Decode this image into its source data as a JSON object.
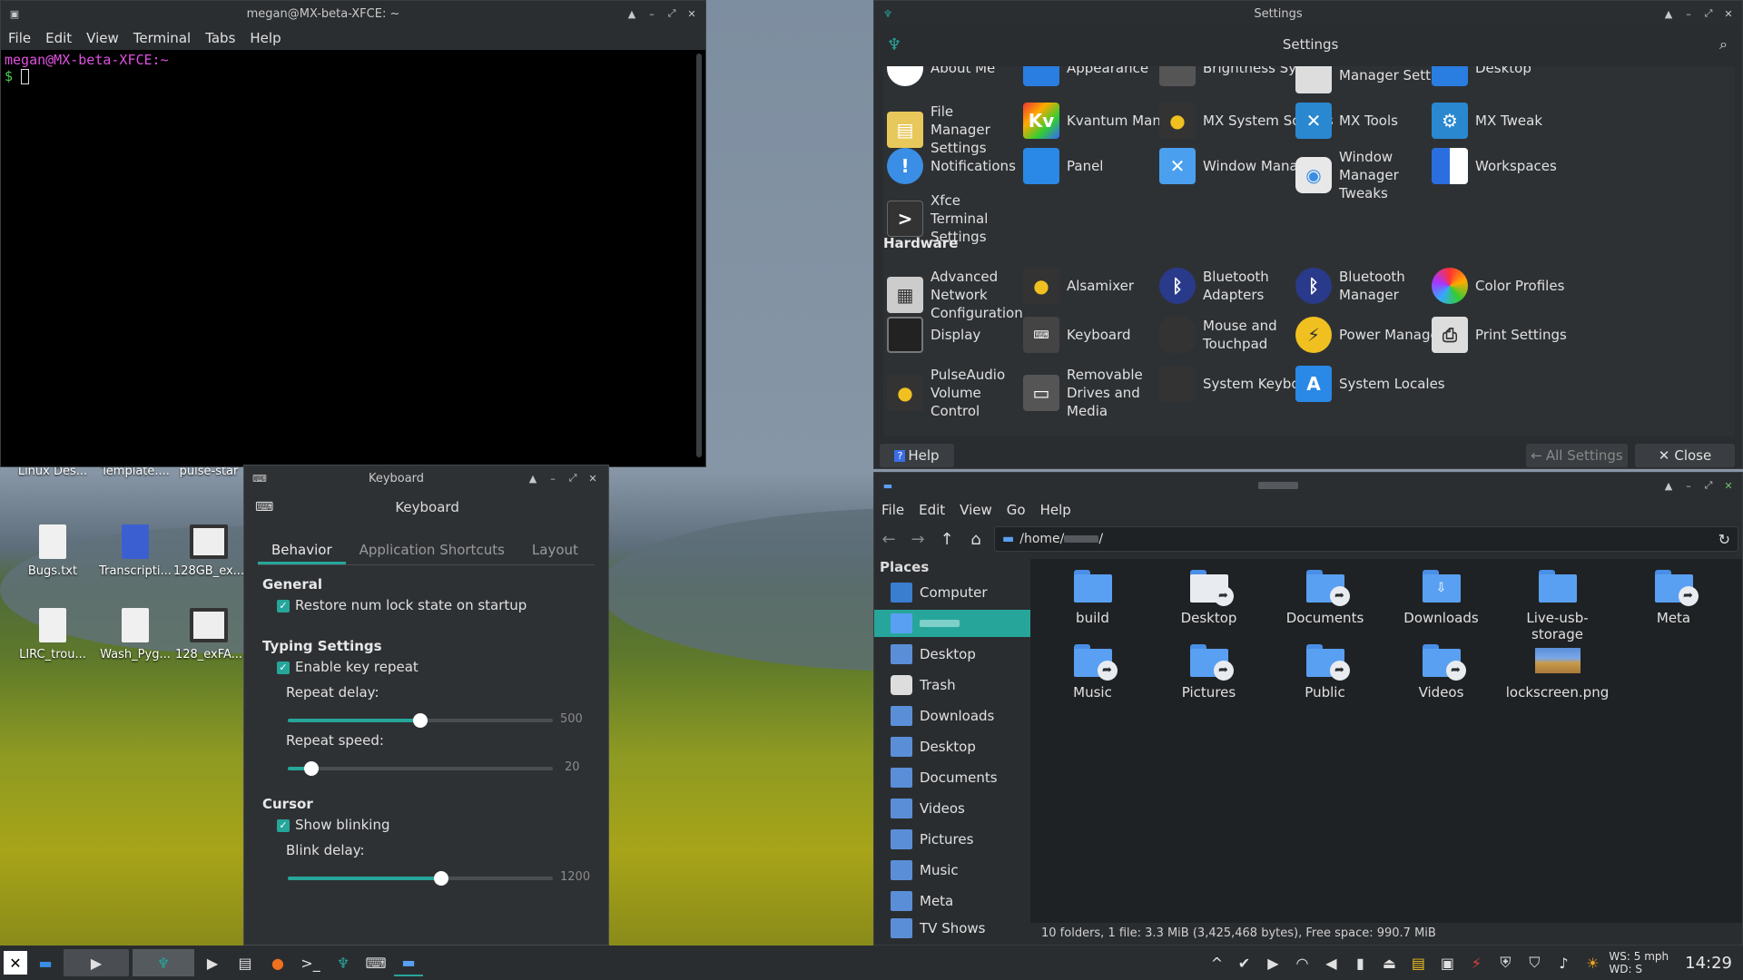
{
  "terminal": {
    "title": "megan@MX-beta-XFCE: ~",
    "menu": [
      "File",
      "Edit",
      "View",
      "Terminal",
      "Tabs",
      "Help"
    ],
    "prompt_user": "megan@MX-beta-XFCE:~",
    "prompt_symbol": "$"
  },
  "settings": {
    "window_title": "Settings",
    "header_title": "Settings",
    "items_top_cut": [
      "About Me",
      "Appearance",
      "Brightness Systray",
      "Manager Settings",
      "Desktop"
    ],
    "personal_items": [
      {
        "label": "File Manager Settings",
        "icon": "file-manager-icon"
      },
      {
        "label": "Kvantum Manager",
        "icon": "kvantum-icon"
      },
      {
        "label": "MX System Sounds",
        "icon": "speaker-icon"
      },
      {
        "label": "MX Tools",
        "icon": "tools-icon"
      },
      {
        "label": "MX Tweak",
        "icon": "tweak-icon"
      },
      {
        "label": "Notifications",
        "icon": "notification-icon"
      },
      {
        "label": "Panel",
        "icon": "panel-icon"
      },
      {
        "label": "Window Manager",
        "icon": "window-manager-icon"
      },
      {
        "label": "Window Manager Tweaks",
        "icon": "toggle-icon"
      },
      {
        "label": "Workspaces",
        "icon": "workspaces-icon"
      },
      {
        "label": "Xfce Terminal Settings",
        "icon": "terminal-settings-icon"
      }
    ],
    "hardware_heading": "Hardware",
    "hardware_items": [
      {
        "label": "Advanced Network Configuration",
        "icon": "network-icon"
      },
      {
        "label": "Alsamixer",
        "icon": "speaker-icon"
      },
      {
        "label": "Bluetooth Adapters",
        "icon": "bluetooth-icon"
      },
      {
        "label": "Bluetooth Manager",
        "icon": "bluetooth-icon"
      },
      {
        "label": "Color Profiles",
        "icon": "color-profiles-icon"
      },
      {
        "label": "Display",
        "icon": "display-icon"
      },
      {
        "label": "Keyboard",
        "icon": "keyboard-icon"
      },
      {
        "label": "Mouse and Touchpad",
        "icon": "mouse-icon"
      },
      {
        "label": "Power Manager",
        "icon": "power-icon"
      },
      {
        "label": "Print Settings",
        "icon": "printer-icon"
      },
      {
        "label": "PulseAudio Volume Control",
        "icon": "speaker-icon"
      },
      {
        "label": "Removable Drives and Media",
        "icon": "drive-icon"
      },
      {
        "label": "System Keyboard",
        "icon": "keyboard-icon"
      },
      {
        "label": "System Locales",
        "icon": "locale-icon"
      }
    ],
    "help_label": "Help",
    "all_settings_label": "All Settings",
    "close_label": "Close"
  },
  "keyboard": {
    "title": "Keyboard",
    "header": "Keyboard",
    "tabs": [
      "Behavior",
      "Application Shortcuts",
      "Layout"
    ],
    "general_heading": "General",
    "numlock_label": "Restore num lock state on startup",
    "typing_heading": "Typing Settings",
    "key_repeat_label": "Enable key repeat",
    "repeat_delay_label": "Repeat delay:",
    "repeat_delay_value": "500",
    "repeat_delay_fraction": 0.5,
    "repeat_speed_label": "Repeat speed:",
    "repeat_speed_value": "20",
    "repeat_speed_fraction": 0.09,
    "cursor_heading": "Cursor",
    "blink_label": "Show blinking",
    "blink_delay_label": "Blink delay:",
    "blink_delay_value": "1200",
    "blink_delay_fraction": 0.58
  },
  "filemgr": {
    "menu": [
      "File",
      "Edit",
      "View",
      "Go",
      "Help"
    ],
    "path_prefix": "/home/",
    "path_suffix": "/",
    "places_heading": "Places",
    "places": [
      "Computer",
      "",
      "Desktop",
      "Trash",
      "Downloads",
      "Desktop",
      "Documents",
      "Videos",
      "Pictures",
      "Music",
      "Meta",
      "TV Shows"
    ],
    "items": [
      "build",
      "Desktop",
      "Documents",
      "Downloads",
      "Live-usb-storage",
      "Meta",
      "Music",
      "Pictures",
      "Public",
      "Videos",
      "lockscreen.png"
    ],
    "status": "10 folders, 1 file: 3.3 MiB (3,425,468 bytes), Free space: 990.7 MiB"
  },
  "desktop": {
    "icons": [
      "Linux Des...",
      "Template....",
      "pulse-star",
      "Bugs.txt",
      "Transcripti...",
      "128GB_ex...",
      "LIRC_trou...",
      "Wash_Pyg...",
      "128_exFA..."
    ]
  },
  "taskbar": {
    "weather_ws": "WS: 5 mph",
    "weather_wd": "WD: S",
    "clock": "14:29"
  },
  "colors": {
    "accent": "#26a69a",
    "folder": "#5aa0f2",
    "panel": "#2a2d30"
  }
}
